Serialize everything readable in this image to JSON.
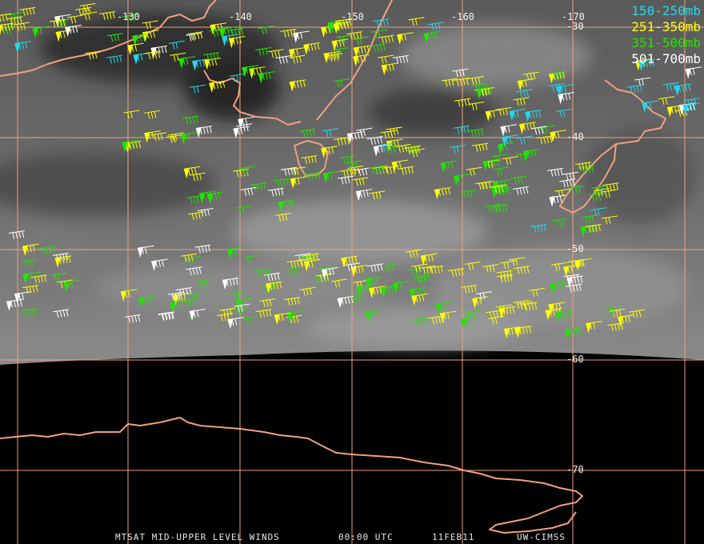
{
  "colors": {
    "grid": "#f0a080",
    "coast": "#f0a080",
    "level_150_250": "#22d8ee",
    "level_251_350": "#ffff00",
    "level_351_500": "#22e400",
    "level_501_700": "#ffffff"
  },
  "lon_labels": [
    "-130",
    "-140",
    "-150",
    "-160",
    "-170"
  ],
  "lat_labels": [
    "-30",
    "-40",
    "-50",
    "-60",
    "-70"
  ],
  "legend": [
    {
      "text": "150-250mb",
      "color": "#22d8ee"
    },
    {
      "text": "251-350mb",
      "color": "#ffff00"
    },
    {
      "text": "351-500mb",
      "color": "#22e400"
    },
    {
      "text": "501-700mb",
      "color": "#ffffff"
    }
  ],
  "footer": {
    "product": "MTSAT MID-UPPER LEVEL WINDS",
    "time": "00:00 UTC",
    "date": "11FEB11",
    "credit": "UW-CIMSS"
  }
}
